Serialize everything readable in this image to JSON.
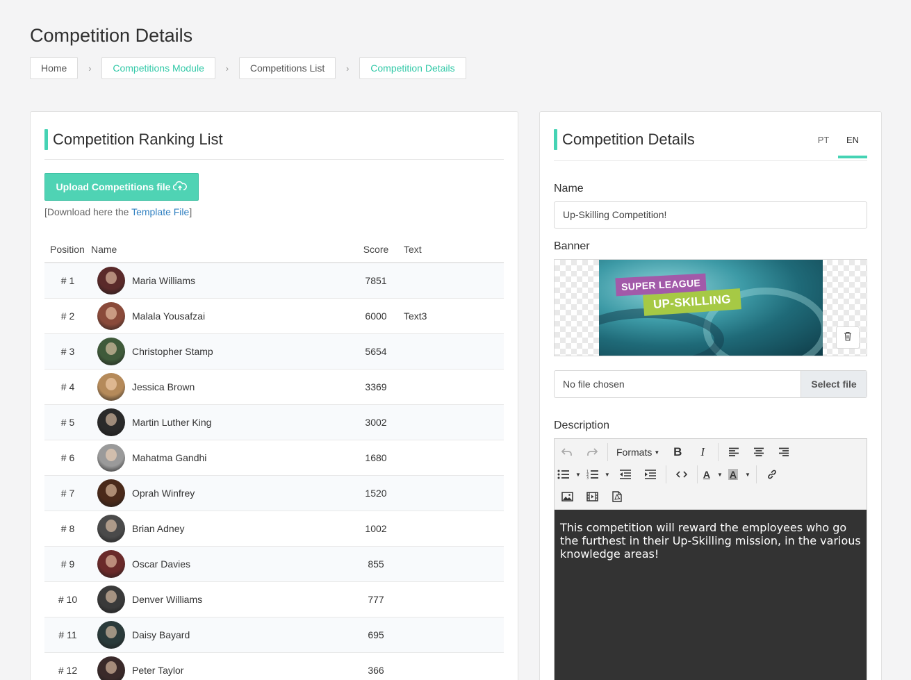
{
  "page": {
    "title": "Competition Details"
  },
  "breadcrumb": [
    "Home",
    "Competitions Module",
    "Competitions List",
    "Competition Details"
  ],
  "left": {
    "title": "Competition Ranking List",
    "upload_label": "Upload Competitions file",
    "download_prefix": "[Download here the ",
    "download_link": "Template File",
    "download_suffix": "]",
    "columns": [
      "Position",
      "Name",
      "Score",
      "Text"
    ],
    "rows": [
      {
        "pos": "# 1",
        "name": "Maria Williams",
        "score": "7851",
        "text": ""
      },
      {
        "pos": "# 2",
        "name": "Malala Yousafzai",
        "score": "6000",
        "text": "Text3"
      },
      {
        "pos": "# 3",
        "name": "Christopher Stamp",
        "score": "5654",
        "text": ""
      },
      {
        "pos": "# 4",
        "name": "Jessica Brown",
        "score": "3369",
        "text": ""
      },
      {
        "pos": "# 5",
        "name": "Martin Luther King",
        "score": "3002",
        "text": ""
      },
      {
        "pos": "# 6",
        "name": "Mahatma Gandhi",
        "score": "1680",
        "text": ""
      },
      {
        "pos": "# 7",
        "name": "Oprah Winfrey",
        "score": "1520",
        "text": ""
      },
      {
        "pos": "# 8",
        "name": "Brian Adney",
        "score": "1002",
        "text": ""
      },
      {
        "pos": "# 9",
        "name": "Oscar Davies",
        "score": "855",
        "text": ""
      },
      {
        "pos": "# 10",
        "name": "Denver Williams",
        "score": "777",
        "text": ""
      },
      {
        "pos": "# 11",
        "name": "Daisy Bayard",
        "score": "695",
        "text": ""
      },
      {
        "pos": "# 12",
        "name": "Peter Taylor",
        "score": "366",
        "text": ""
      }
    ]
  },
  "right": {
    "title": "Competition Details",
    "tabs": [
      "PT",
      "EN"
    ],
    "active_tab": "EN",
    "name_label": "Name",
    "name_value": "Up-Skilling Competition!",
    "banner_label": "Banner",
    "banner_text_1": "SUPER LEAGUE",
    "banner_text_2": "UP-SKILLING",
    "file_status": "No file chosen",
    "select_file_label": "Select file",
    "description_label": "Description",
    "formats_label": "Formats",
    "description_text": "This competition will reward the employees who go the furthest in their Up-Skilling mission, in the various knowledge areas!"
  },
  "colors": {
    "accent": "#45d3b4",
    "link": "#2f7fc0",
    "editor_bg": "#333333"
  },
  "avatar_colors": [
    "#5a2a2a",
    "#8a4a3a",
    "#3f5a3a",
    "#b58a5a",
    "#2a2a2a",
    "#9a9a9a",
    "#4a2a1a",
    "#4a4a4a",
    "#6a2a2a",
    "#3a3a3a",
    "#2a3a3a",
    "#3a2a2a"
  ]
}
